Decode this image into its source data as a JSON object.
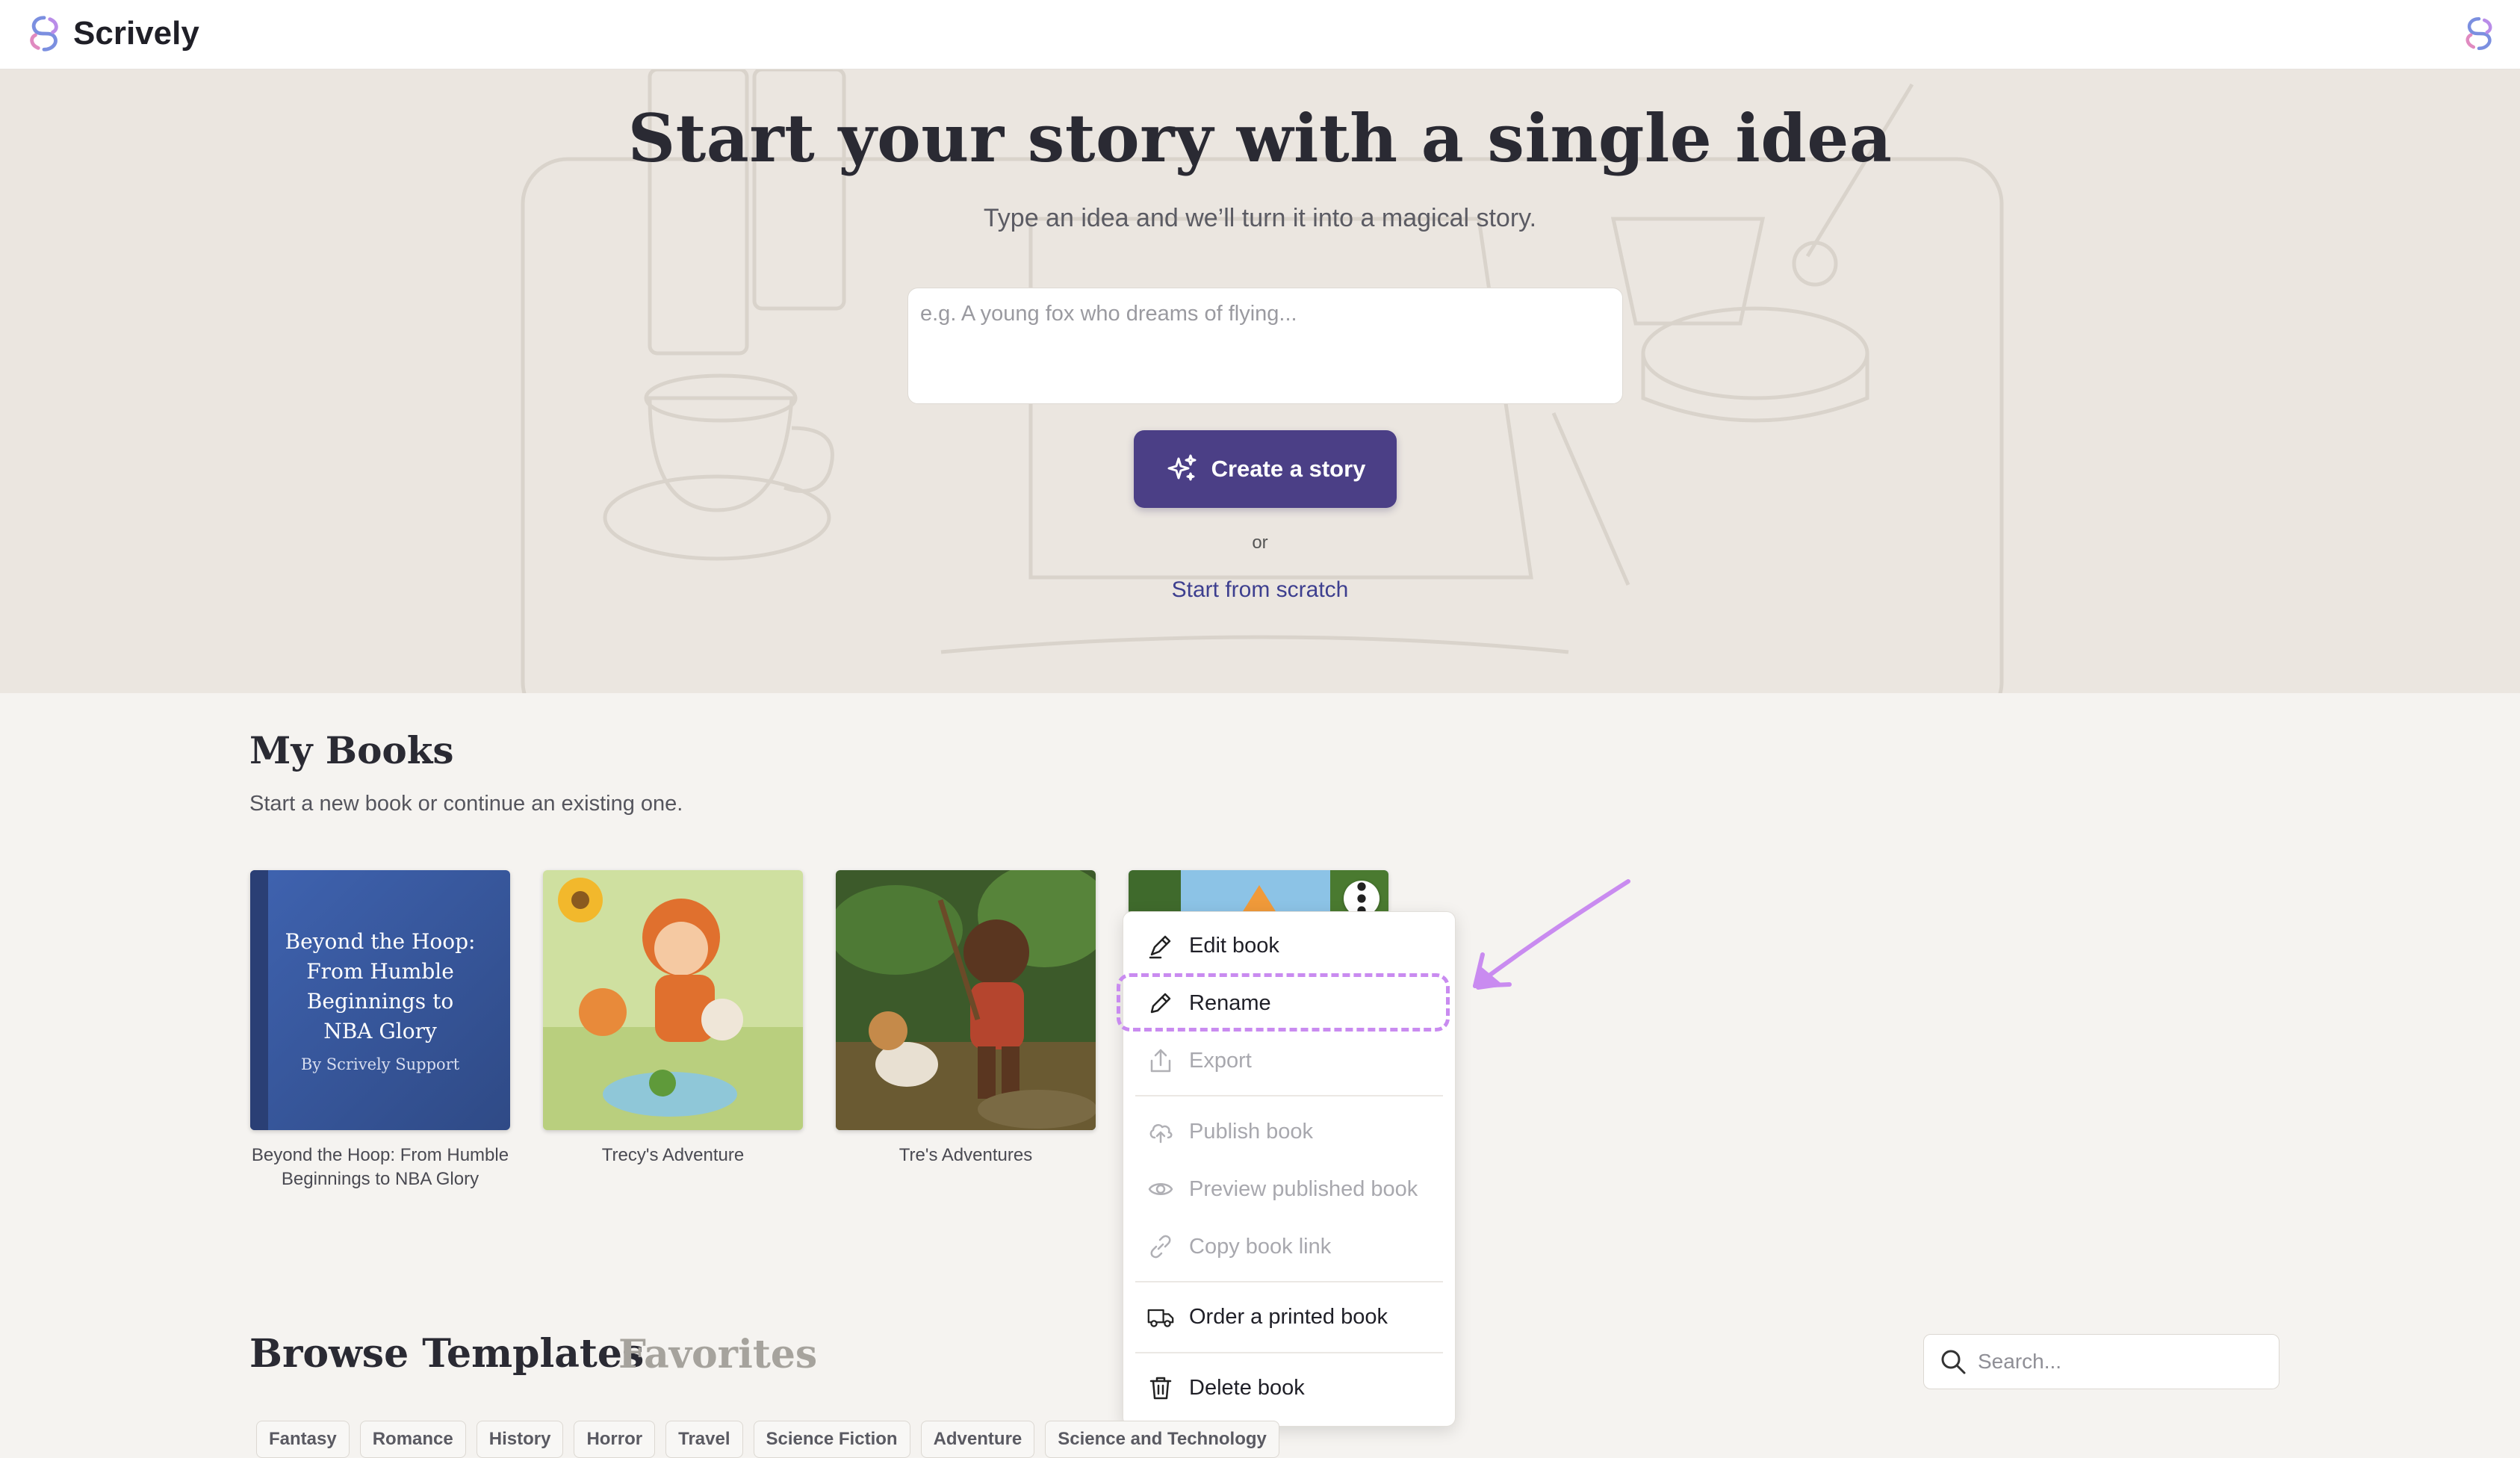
{
  "app": {
    "name": "Scrively"
  },
  "hero": {
    "title": "Start your story with a single idea",
    "subtitle": "Type an idea and we’ll turn it into a magical story.",
    "input_placeholder": "e.g. A young fox who dreams of flying...",
    "create_label": "Create a story",
    "or_text": "or",
    "scratch_label": "Start from scratch"
  },
  "my_books": {
    "title": "My Books",
    "subtitle": "Start a new book or continue an existing one.",
    "books": [
      {
        "caption": "Beyond the Hoop: From Humble Beginnings to NBA Glory",
        "cover_title": "Beyond the Hoop: From Humble Beginnings to NBA Glory",
        "cover_author": "By Scrively Support"
      },
      {
        "caption": "Trecy's Adventure"
      },
      {
        "caption": "Tre's Adventures"
      },
      {
        "caption": ""
      }
    ]
  },
  "context_menu": {
    "items": [
      {
        "label": "Edit book",
        "icon": "edit-book-icon",
        "enabled": true
      },
      {
        "label": "Rename",
        "icon": "pencil-icon",
        "enabled": true
      },
      {
        "label": "Export",
        "icon": "export-icon",
        "enabled": false
      },
      {
        "label": "Publish book",
        "icon": "cloud-upload-icon",
        "enabled": false
      },
      {
        "label": "Preview published book",
        "icon": "eye-icon",
        "enabled": false
      },
      {
        "label": "Copy book link",
        "icon": "link-icon",
        "enabled": false
      },
      {
        "label": "Order a printed book",
        "icon": "truck-icon",
        "enabled": true
      },
      {
        "label": "Delete book",
        "icon": "trash-icon",
        "enabled": true
      }
    ]
  },
  "browse": {
    "tabs": [
      "Browse Templates",
      "Favorites"
    ],
    "search_placeholder": "Search...",
    "categories": [
      "Fantasy",
      "Romance",
      "History",
      "Horror",
      "Travel",
      "Science Fiction",
      "Adventure",
      "Science and Technology"
    ]
  },
  "colors": {
    "primary": "#4b3f86",
    "link": "#3d3f8f",
    "annotation": "#c98bf0"
  }
}
